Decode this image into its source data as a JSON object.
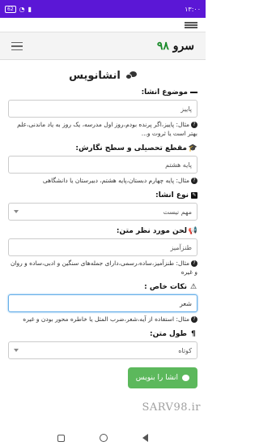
{
  "statusbar": {
    "time": "۱۳:۰۰",
    "battery": "62",
    "wifi_icon": "wifi-icon",
    "signal_icon": "signal-icon"
  },
  "brand": {
    "name": "سرو",
    "number": "۹۸"
  },
  "page": {
    "heading": "انشانویس"
  },
  "fields": {
    "topic": {
      "label": "موضوع انشا:",
      "value": "پاییز",
      "hint": "مثال: پاییز،اگر پرنده بودم،روز اول مدرسه، یک روز به یاد ماندنی،علم بهتر است یا ثروت و..."
    },
    "grade": {
      "label": "مقطع تحصیلی و سطح نگارش:",
      "value": "پایه هشتم",
      "hint": "مثال: پایه چهارم دبستان،پایه هشتم، دبیرستان یا دانشگاهی"
    },
    "type": {
      "label": "نوع انشا:",
      "value": "مهم نیست"
    },
    "tone": {
      "label": "لحن مورد نظر متن:",
      "value": "طنزآمیز",
      "hint": "مثال: طنزآمیز،ساده،رسمی،دارای جمله‌های سنگین و ادبی،ساده و روان و غیره"
    },
    "special": {
      "label": "نکات خاص :",
      "value": "شعر",
      "hint": "مثال: استفاده از آیه،شعر،ضرب المثل یا خاطره محور بودن و غیره"
    },
    "length": {
      "label": "طول متن:",
      "value": "کوتاه"
    }
  },
  "submit_label": "انشا را بنویس",
  "watermark": "SARV98.ir"
}
